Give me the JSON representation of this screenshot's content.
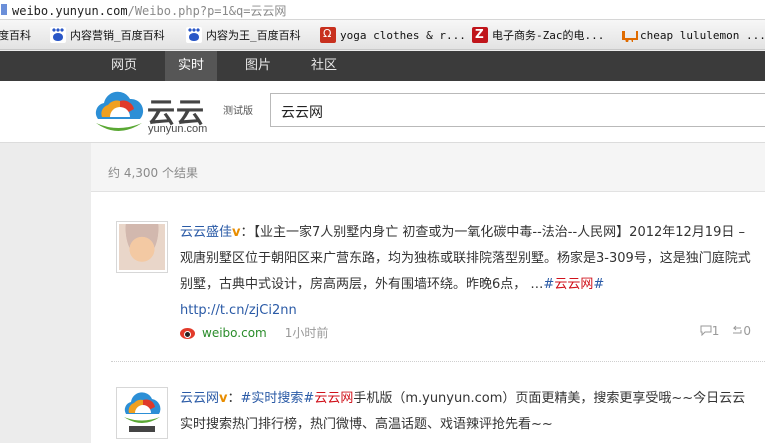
{
  "browser": {
    "address_host": "weibo.yunyun.com",
    "address_path": "/Weibo.php?p=1&q=云云网",
    "bookmarks": [
      {
        "label": "度百科",
        "icon": "paw-icon"
      },
      {
        "label": "内容营销_百度百科",
        "icon": "paw-icon"
      },
      {
        "label": "内容为王_百度百科",
        "icon": "paw-icon"
      },
      {
        "label": "yoga clothes & r...",
        "icon": "lululemon-icon"
      },
      {
        "label": "电子商务-Zac的电...",
        "icon": "z-icon"
      },
      {
        "label": "cheap lululemon ...",
        "icon": "cart-icon"
      }
    ]
  },
  "nav": {
    "items": [
      "网页",
      "实时",
      "图片",
      "社区"
    ],
    "active_index": 1
  },
  "header": {
    "logo_word": "云云",
    "logo_domain": "yunyun.com",
    "logo_beta": "测试版",
    "search_value": "云云网"
  },
  "results": {
    "count_text": "约 4,300 个结果",
    "items": [
      {
        "user": "云云盛佳",
        "verified_mark": "v",
        "sep": "：",
        "text": "【业主一家7人别墅内身亡 初查或为一氧化碳中毒--法治--人民网】2012年12月19日 – 观唐别墅区位于朝阳区来广营东路，均为独栋或联排院落型别墅。杨家是3-309号，这是独门庭院式别墅，古典中式设计，房高两层，外有围墙环绕。昨晚6点，  …",
        "tag_prefix": "#",
        "tag_hl": "云云网",
        "tag_suffix": "#",
        "link": "http://t.cn/zjCi2nn",
        "source": "weibo.com",
        "time": "1小时前",
        "comments": "1",
        "reposts": "0"
      },
      {
        "user": "云云网",
        "verified_mark": "v",
        "sep": "：",
        "tag1": "#实时搜索#",
        "tag2_hl": "云云网",
        "text": "手机版（m.yunyun.com）页面更精美，搜索更享受哦~~今日云云实时搜索热门排行榜，热门微博、高温话题、戏语辣评抢先看~~"
      }
    ]
  },
  "colors": {
    "nav_bg": "#3b3b3b",
    "link_blue": "#2a5aa6",
    "highlight_red": "#d0121b",
    "verified_orange": "#e88d00"
  }
}
